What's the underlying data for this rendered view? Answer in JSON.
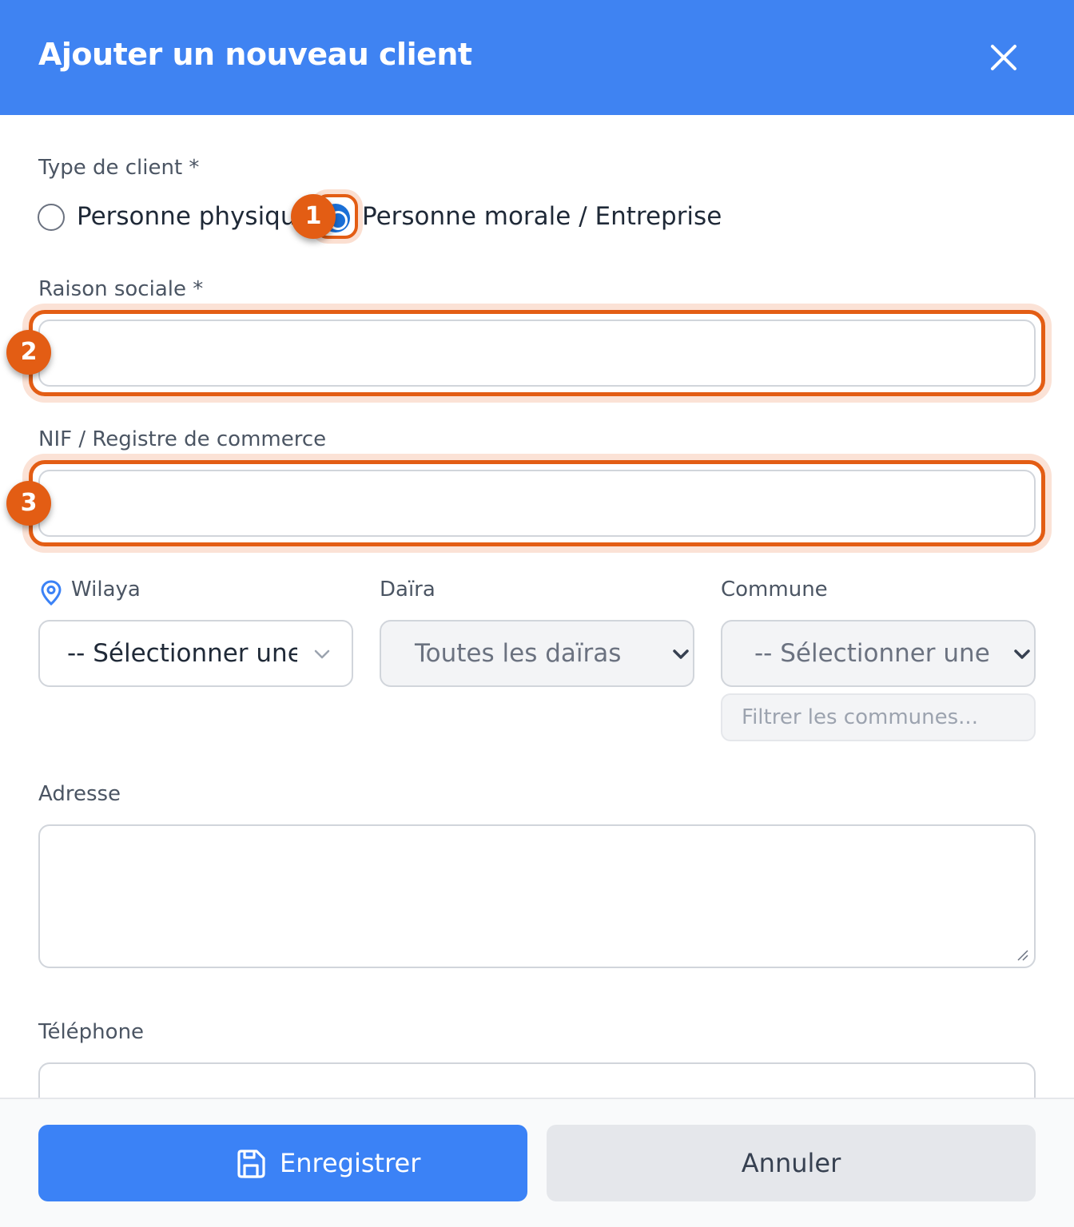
{
  "header": {
    "title": "Ajouter un nouveau client"
  },
  "client_type": {
    "label": "Type de client *",
    "options": [
      {
        "label": "Personne physique",
        "checked": false
      },
      {
        "label": "Personne morale / Entreprise",
        "checked": true
      }
    ]
  },
  "raison_sociale": {
    "label": "Raison sociale *",
    "value": ""
  },
  "nif": {
    "label": "NIF / Registre de commerce",
    "value": ""
  },
  "location": {
    "wilaya": {
      "label": "Wilaya",
      "selected": "-- Sélectionner une"
    },
    "daira": {
      "label": "Daïra",
      "selected": "Toutes les daïras"
    },
    "commune": {
      "label": "Commune",
      "selected": "-- Sélectionner une",
      "filter_placeholder": "Filtrer les communes..."
    }
  },
  "adresse": {
    "label": "Adresse",
    "value": ""
  },
  "telephone": {
    "label": "Téléphone",
    "value": ""
  },
  "footer": {
    "save_label": "Enregistrer",
    "cancel_label": "Annuler"
  },
  "annotations": [
    "1",
    "2",
    "3"
  ],
  "colors": {
    "header": "#3f83f2",
    "accent": "#3b82f6",
    "highlight": "#e35d14"
  }
}
